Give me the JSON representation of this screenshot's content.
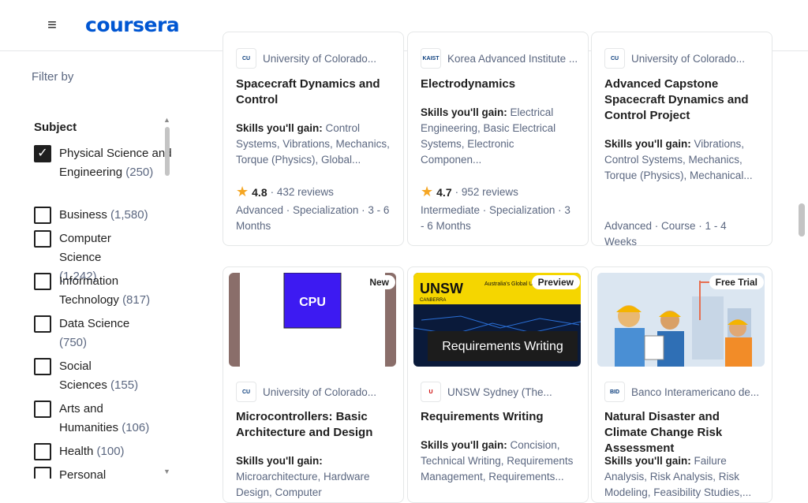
{
  "header": {
    "menu_icon": "hamburger-icon",
    "logo": "coursera"
  },
  "sidebar": {
    "filter_by": "Filter by",
    "subject_title": "Subject",
    "options": [
      {
        "label": "Physical Science and Engineering",
        "count": "(250)",
        "checked": true
      },
      {
        "label": "Business",
        "count": "(1,580)",
        "checked": false
      },
      {
        "label": "Computer Science",
        "count": "(1,242)",
        "checked": false
      },
      {
        "label": "Information Technology",
        "count": "(817)",
        "checked": false
      },
      {
        "label": "Data Science",
        "count": "(750)",
        "checked": false
      },
      {
        "label": "Social Sciences",
        "count": "(155)",
        "checked": false
      },
      {
        "label": "Arts and Humanities",
        "count": "(106)",
        "checked": false
      },
      {
        "label": "Health",
        "count": "(100)",
        "checked": false
      },
      {
        "label": "Personal",
        "count": "",
        "checked": false
      }
    ]
  },
  "cards": [
    {
      "partner": "University of Colorado...",
      "title": "Spacecraft Dynamics and Control",
      "skills_label": "Skills you'll gain:",
      "skills": "Control Systems, Vibrations, Mechanics, Torque (Physics), Global...",
      "rating": "4.8",
      "reviews": "· 432 reviews",
      "meta": "Advanced · Specialization · 3 - 6 Months"
    },
    {
      "partner": "Korea Advanced Institute ...",
      "partner_logo": "KAIST",
      "title": "Electrodynamics",
      "skills_label": "Skills you'll gain:",
      "skills": "Electrical Engineering, Basic Electrical Systems, Electronic Componen...",
      "rating": "4.7",
      "reviews": "· 952 reviews",
      "meta": "Intermediate · Specialization · 3 - 6 Months"
    },
    {
      "partner": "University of Colorado...",
      "title": "Advanced Capstone Spacecraft Dynamics and Control Project",
      "skills_label": "Skills you'll gain:",
      "skills": "Vibrations, Control Systems, Mechanics, Torque (Physics), Mechanical...",
      "meta": "Advanced · Course · 1 - 4 Weeks"
    },
    {
      "badge": "New",
      "image_text": "CPU",
      "partner": "University of Colorado...",
      "title": "Microcontrollers: Basic Architecture and Design",
      "skills_label": "Skills you'll gain:",
      "skills": "Microarchitecture, Hardware Design, Computer Architecture,..."
    },
    {
      "badge": "Preview",
      "image_text": "Requirements Writing",
      "image_brand": "UNSW",
      "image_brand_sub": "Australia's Global University",
      "image_brand_campus": "CANBERRA",
      "partner": "UNSW Sydney (The...",
      "title": "Requirements Writing",
      "skills_label": "Skills you'll gain:",
      "skills": "Concision, Technical Writing, Requirements Management, Requirements..."
    },
    {
      "badge": "Free Trial",
      "partner": "Banco Interamericano de...",
      "title": "Natural Disaster and Climate Change Risk Assessment",
      "skills_label": "Skills you'll gain:",
      "skills": "Failure Analysis, Risk Analysis, Risk Modeling, Feasibility Studies,..."
    }
  ]
}
